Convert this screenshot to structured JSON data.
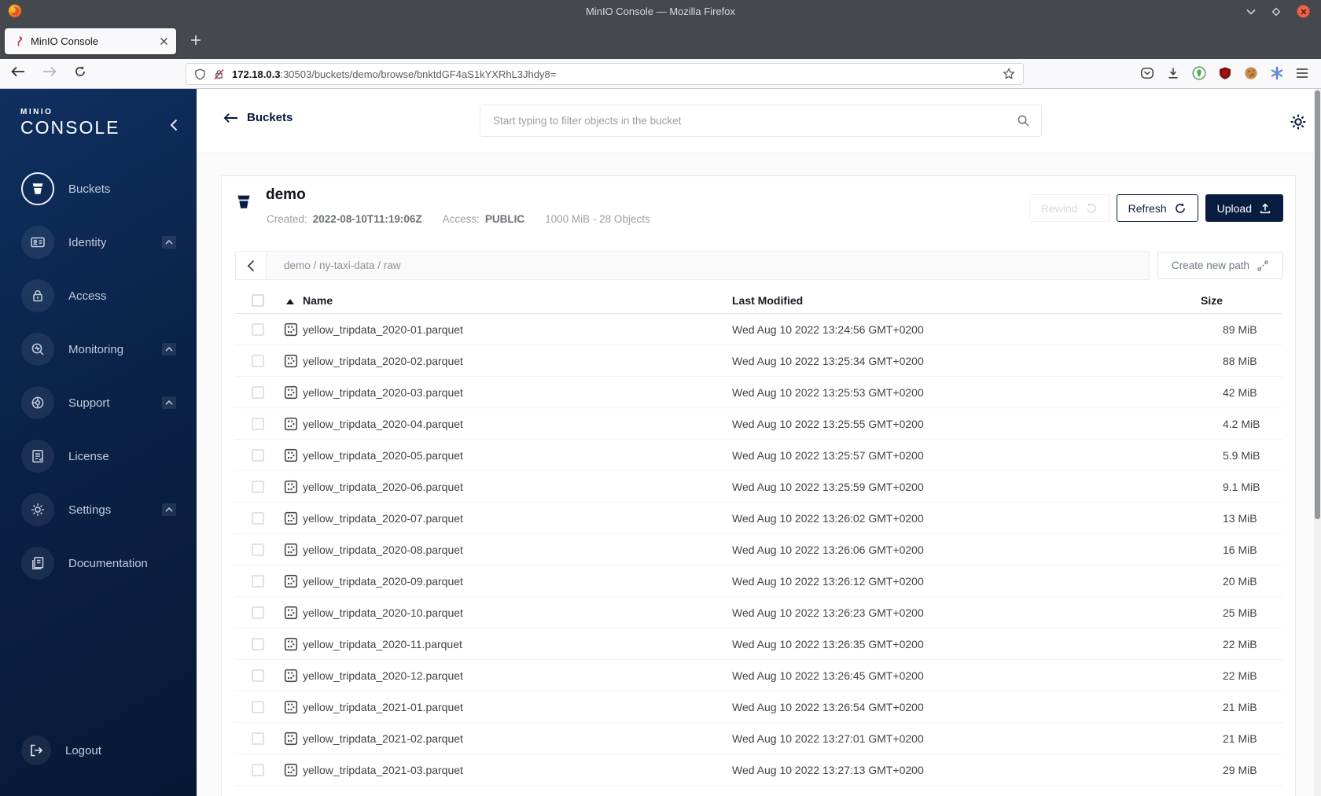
{
  "titlebar": {
    "title": "MinIO Console — Mozilla Firefox"
  },
  "tabs": {
    "active_title": "MinIO Console"
  },
  "urlbar": {
    "host": "172.18.0.3",
    "path": ":30503/buckets/demo/browse/bnktdGF4aS1kYXRhL3Jhdy8="
  },
  "sidebar": {
    "brand_top": "MINIO",
    "brand_bottom": "CONSOLE",
    "items": [
      {
        "label": "Buckets",
        "icon": "buckets-icon",
        "active": true,
        "expandable": false
      },
      {
        "label": "Identity",
        "icon": "identity-icon",
        "active": false,
        "expandable": true
      },
      {
        "label": "Access",
        "icon": "access-lock-icon",
        "active": false,
        "expandable": false
      },
      {
        "label": "Monitoring",
        "icon": "monitoring-icon",
        "active": false,
        "expandable": true
      },
      {
        "label": "Support",
        "icon": "support-icon",
        "active": false,
        "expandable": true
      },
      {
        "label": "License",
        "icon": "license-icon",
        "active": false,
        "expandable": false
      },
      {
        "label": "Settings",
        "icon": "settings-gear-icon",
        "active": false,
        "expandable": true
      },
      {
        "label": "Documentation",
        "icon": "documentation-icon",
        "active": false,
        "expandable": false
      }
    ],
    "logout_label": "Logout"
  },
  "content_header": {
    "back_label": "Buckets",
    "search_placeholder": "Start typing to filter objects in the bucket"
  },
  "bucket": {
    "name": "demo",
    "created_label": "Created:",
    "created_value": "2022-08-10T11:19:06Z",
    "access_label": "Access:",
    "access_value": "PUBLIC",
    "usage": "1000 MiB - 28 Objects",
    "rewind_label": "Rewind",
    "refresh_label": "Refresh",
    "upload_label": "Upload"
  },
  "path_bar": {
    "path": "demo / ny-taxi-data / raw",
    "create_label": "Create new path"
  },
  "table": {
    "headers": {
      "name": "Name",
      "modified": "Last Modified",
      "size": "Size"
    },
    "rows": [
      {
        "name": "yellow_tripdata_2020-01.parquet",
        "modified": "Wed Aug 10 2022 13:24:56 GMT+0200",
        "size": "89 MiB"
      },
      {
        "name": "yellow_tripdata_2020-02.parquet",
        "modified": "Wed Aug 10 2022 13:25:34 GMT+0200",
        "size": "88 MiB"
      },
      {
        "name": "yellow_tripdata_2020-03.parquet",
        "modified": "Wed Aug 10 2022 13:25:53 GMT+0200",
        "size": "42 MiB"
      },
      {
        "name": "yellow_tripdata_2020-04.parquet",
        "modified": "Wed Aug 10 2022 13:25:55 GMT+0200",
        "size": "4.2 MiB"
      },
      {
        "name": "yellow_tripdata_2020-05.parquet",
        "modified": "Wed Aug 10 2022 13:25:57 GMT+0200",
        "size": "5.9 MiB"
      },
      {
        "name": "yellow_tripdata_2020-06.parquet",
        "modified": "Wed Aug 10 2022 13:25:59 GMT+0200",
        "size": "9.1 MiB"
      },
      {
        "name": "yellow_tripdata_2020-07.parquet",
        "modified": "Wed Aug 10 2022 13:26:02 GMT+0200",
        "size": "13 MiB"
      },
      {
        "name": "yellow_tripdata_2020-08.parquet",
        "modified": "Wed Aug 10 2022 13:26:06 GMT+0200",
        "size": "16 MiB"
      },
      {
        "name": "yellow_tripdata_2020-09.parquet",
        "modified": "Wed Aug 10 2022 13:26:12 GMT+0200",
        "size": "20 MiB"
      },
      {
        "name": "yellow_tripdata_2020-10.parquet",
        "modified": "Wed Aug 10 2022 13:26:23 GMT+0200",
        "size": "25 MiB"
      },
      {
        "name": "yellow_tripdata_2020-11.parquet",
        "modified": "Wed Aug 10 2022 13:26:35 GMT+0200",
        "size": "22 MiB"
      },
      {
        "name": "yellow_tripdata_2020-12.parquet",
        "modified": "Wed Aug 10 2022 13:26:45 GMT+0200",
        "size": "22 MiB"
      },
      {
        "name": "yellow_tripdata_2021-01.parquet",
        "modified": "Wed Aug 10 2022 13:26:54 GMT+0200",
        "size": "21 MiB"
      },
      {
        "name": "yellow_tripdata_2021-02.parquet",
        "modified": "Wed Aug 10 2022 13:27:01 GMT+0200",
        "size": "21 MiB"
      },
      {
        "name": "yellow_tripdata_2021-03.parquet",
        "modified": "Wed Aug 10 2022 13:27:13 GMT+0200",
        "size": "29 MiB"
      }
    ]
  },
  "colors": {
    "accent_navy": "#081C42",
    "sidebar_top": "#103060",
    "sidebar_bottom": "#071834",
    "close_button": "#e8684e",
    "minio_brand_red": "#c72c48"
  }
}
